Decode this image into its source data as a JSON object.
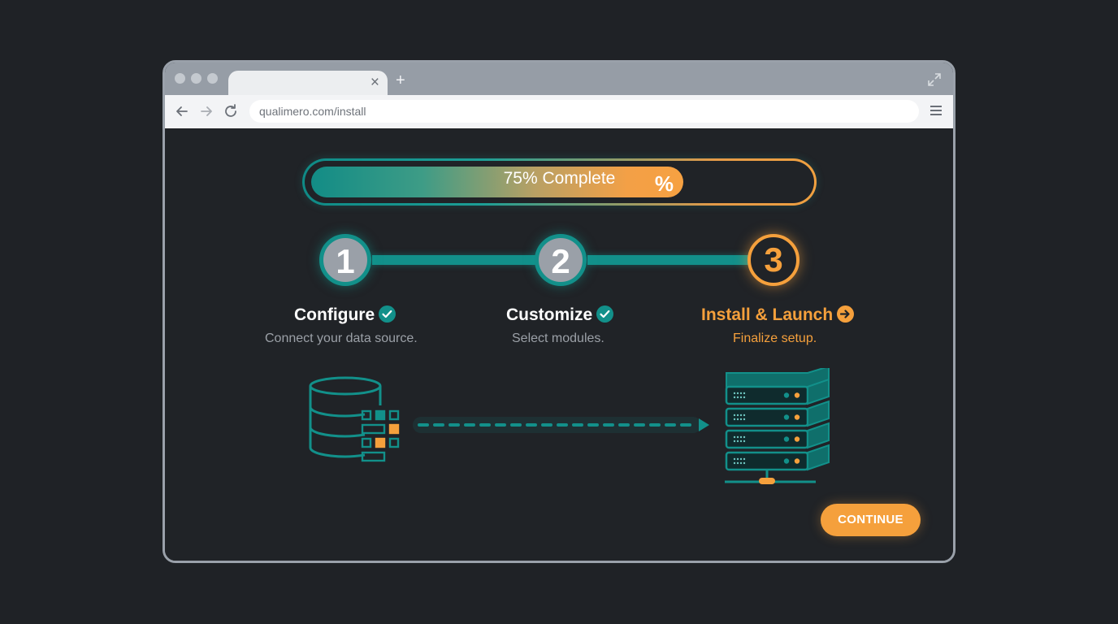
{
  "browser": {
    "url": "qualimero.com/install"
  },
  "progress": {
    "label": "75% Complete",
    "symbol": "%",
    "percent": 75
  },
  "steps": [
    {
      "number": "1",
      "title": "Configure",
      "description": "Connect your data source.",
      "status": "complete",
      "status_icon": "check-circle-icon"
    },
    {
      "number": "2",
      "title": "Customize",
      "description": "Select modules.",
      "status": "complete",
      "status_icon": "check-circle-icon"
    },
    {
      "number": "3",
      "title": "Install & Launch",
      "description": "Finalize setup.",
      "status": "current",
      "status_icon": "arrow-right-circle-icon"
    }
  ],
  "illustration": {
    "source_icon": "database-icon",
    "flow_icon": "dashed-arrow-icon",
    "target_icon": "server-rack-icon"
  },
  "actions": {
    "continue_label": "CONTINUE"
  },
  "colors": {
    "accent_teal": "#12908a",
    "accent_orange": "#f5a03c",
    "background": "#202327",
    "step_done_fill": "#9aa0a8"
  }
}
